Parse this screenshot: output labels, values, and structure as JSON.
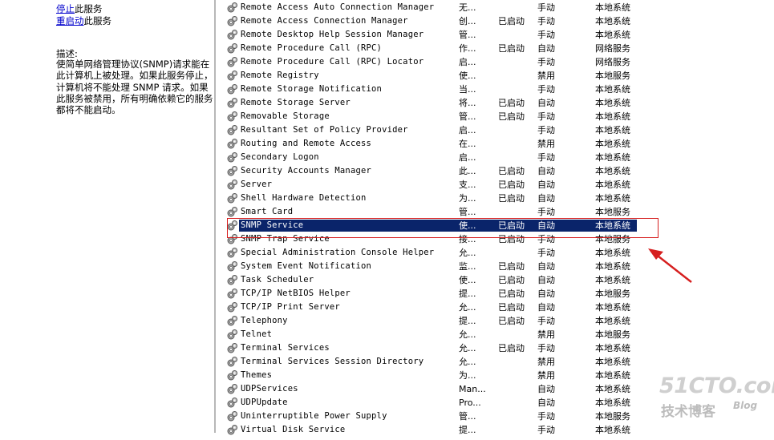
{
  "left_pane": {
    "stop_link": "停止",
    "stop_suffix": "此服务",
    "restart_link": "重启动",
    "restart_suffix": "此服务",
    "desc_label": "描述:",
    "description": "使简单网络管理协议(SNMP)请求能在此计算机上被处理。如果此服务停止，计算机将不能处理 SNMP 请求。如果此服务被禁用，所有明确依赖它的服务都将不能启动。"
  },
  "services": [
    {
      "name": "Remote Access Auto Connection Manager",
      "desc": "无...",
      "status": "",
      "startup": "手动",
      "logon": "本地系统"
    },
    {
      "name": "Remote Access Connection Manager",
      "desc": "创...",
      "status": "已启动",
      "startup": "手动",
      "logon": "本地系统"
    },
    {
      "name": "Remote Desktop Help Session Manager",
      "desc": "管...",
      "status": "",
      "startup": "手动",
      "logon": "本地系统"
    },
    {
      "name": "Remote Procedure Call (RPC)",
      "desc": "作...",
      "status": "已启动",
      "startup": "自动",
      "logon": "网络服务"
    },
    {
      "name": "Remote Procedure Call (RPC) Locator",
      "desc": "启...",
      "status": "",
      "startup": "手动",
      "logon": "网络服务"
    },
    {
      "name": "Remote Registry",
      "desc": "使...",
      "status": "",
      "startup": "禁用",
      "logon": "本地服务"
    },
    {
      "name": "Remote Storage Notification",
      "desc": "当...",
      "status": "",
      "startup": "手动",
      "logon": "本地系统"
    },
    {
      "name": "Remote Storage Server",
      "desc": "将...",
      "status": "已启动",
      "startup": "自动",
      "logon": "本地系统"
    },
    {
      "name": "Removable Storage",
      "desc": "管...",
      "status": "已启动",
      "startup": "手动",
      "logon": "本地系统"
    },
    {
      "name": "Resultant Set of Policy Provider",
      "desc": "启...",
      "status": "",
      "startup": "手动",
      "logon": "本地系统"
    },
    {
      "name": "Routing and Remote Access",
      "desc": "在...",
      "status": "",
      "startup": "禁用",
      "logon": "本地系统"
    },
    {
      "name": "Secondary Logon",
      "desc": "启...",
      "status": "",
      "startup": "手动",
      "logon": "本地系统"
    },
    {
      "name": "Security Accounts Manager",
      "desc": "此...",
      "status": "已启动",
      "startup": "自动",
      "logon": "本地系统"
    },
    {
      "name": "Server",
      "desc": "支...",
      "status": "已启动",
      "startup": "自动",
      "logon": "本地系统"
    },
    {
      "name": "Shell Hardware Detection",
      "desc": "为...",
      "status": "已启动",
      "startup": "自动",
      "logon": "本地系统"
    },
    {
      "name": "Smart Card",
      "desc": "管...",
      "status": "",
      "startup": "手动",
      "logon": "本地服务"
    },
    {
      "name": "SNMP Service",
      "desc": "使...",
      "status": "已启动",
      "startup": "自动",
      "logon": "本地系统"
    },
    {
      "name": "SNMP Trap Service",
      "desc": "接...",
      "status": "已启动",
      "startup": "手动",
      "logon": "本地服务"
    },
    {
      "name": "Special Administration Console Helper",
      "desc": "允...",
      "status": "",
      "startup": "手动",
      "logon": "本地系统"
    },
    {
      "name": "System Event Notification",
      "desc": "监...",
      "status": "已启动",
      "startup": "自动",
      "logon": "本地系统"
    },
    {
      "name": "Task Scheduler",
      "desc": "使...",
      "status": "已启动",
      "startup": "自动",
      "logon": "本地系统"
    },
    {
      "name": "TCP/IP NetBIOS Helper",
      "desc": "提...",
      "status": "已启动",
      "startup": "自动",
      "logon": "本地服务"
    },
    {
      "name": "TCP/IP Print Server",
      "desc": "允...",
      "status": "已启动",
      "startup": "自动",
      "logon": "本地系统"
    },
    {
      "name": "Telephony",
      "desc": "提...",
      "status": "已启动",
      "startup": "手动",
      "logon": "本地系统"
    },
    {
      "name": "Telnet",
      "desc": "允...",
      "status": "",
      "startup": "禁用",
      "logon": "本地服务"
    },
    {
      "name": "Terminal Services",
      "desc": "允...",
      "status": "已启动",
      "startup": "手动",
      "logon": "本地系统"
    },
    {
      "name": "Terminal Services Session Directory",
      "desc": "允...",
      "status": "",
      "startup": "禁用",
      "logon": "本地系统"
    },
    {
      "name": "Themes",
      "desc": "为...",
      "status": "",
      "startup": "禁用",
      "logon": "本地系统"
    },
    {
      "name": "UDPServices",
      "desc": "Man...",
      "status": "",
      "startup": "自动",
      "logon": "本地系统"
    },
    {
      "name": "UDPUpdate",
      "desc": "Pro...",
      "status": "",
      "startup": "自动",
      "logon": "本地系统"
    },
    {
      "name": "Uninterruptible Power Supply",
      "desc": "管...",
      "status": "",
      "startup": "手动",
      "logon": "本地服务"
    },
    {
      "name": "Virtual Disk Service",
      "desc": "提...",
      "status": "",
      "startup": "手动",
      "logon": "本地系统"
    }
  ],
  "selected_index": 16,
  "watermark": {
    "main": "51CTO.com",
    "sub": "技术博客",
    "blog": "Blog"
  },
  "colors": {
    "selection": "#0a246a",
    "highlight_box": "#d61f1f",
    "link": "#0000cc"
  }
}
